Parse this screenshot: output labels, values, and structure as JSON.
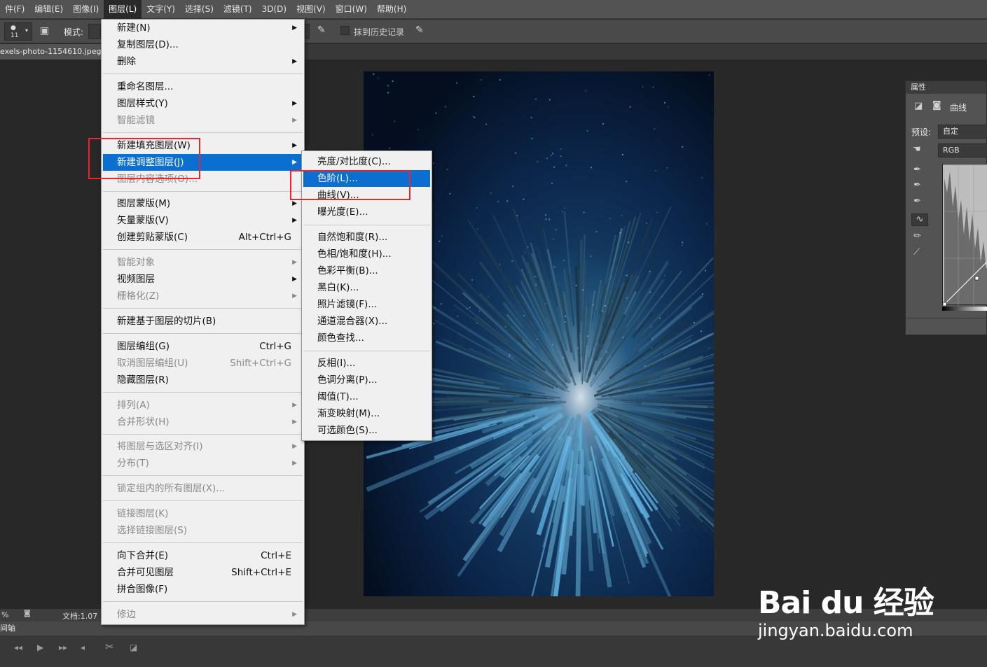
{
  "menubar": {
    "items": [
      {
        "label": "件(F)"
      },
      {
        "label": "编辑(E)"
      },
      {
        "label": "图像(I)"
      },
      {
        "label": "图层(L)",
        "active": true
      },
      {
        "label": "文字(Y)"
      },
      {
        "label": "选择(S)"
      },
      {
        "label": "滤镜(T)"
      },
      {
        "label": "3D(D)"
      },
      {
        "label": "视图(V)"
      },
      {
        "label": "窗口(W)"
      },
      {
        "label": "帮助(H)"
      }
    ]
  },
  "options_bar": {
    "brush_size": "11",
    "mode_label": "模式:",
    "history_label": "抹到历史记录"
  },
  "document": {
    "tab_title": "exels-photo-1154610.jpeg"
  },
  "status_bar": {
    "zoom": "%",
    "doc_info": "文档:1.07"
  },
  "timeline": {
    "title": "间轴"
  },
  "properties_panel": {
    "title": "属性",
    "type_label": "曲线",
    "preset_label": "预设:",
    "preset_value": "自定",
    "channel_value": "RGB"
  },
  "layer_menu": {
    "items": [
      {
        "label": "新建(N)",
        "submenu": true
      },
      {
        "label": "复制图层(D)..."
      },
      {
        "label": "删除",
        "submenu": true
      },
      {
        "separator": true
      },
      {
        "label": "重命名图层..."
      },
      {
        "label": "图层样式(Y)",
        "submenu": true
      },
      {
        "label": "智能滤镜",
        "disabled": true,
        "submenu": true
      },
      {
        "separator": true
      },
      {
        "label": "新建填充图层(W)",
        "submenu": true
      },
      {
        "label": "新建调整图层(J)",
        "submenu": true,
        "highlight": true
      },
      {
        "label": "图层内容选项(O)...",
        "disabled": true
      },
      {
        "separator": true
      },
      {
        "label": "图层蒙版(M)",
        "submenu": true
      },
      {
        "label": "矢量蒙版(V)",
        "submenu": true
      },
      {
        "label": "创建剪贴蒙版(C)",
        "shortcut": "Alt+Ctrl+G"
      },
      {
        "separator": true
      },
      {
        "label": "智能对象",
        "disabled": true,
        "submenu": true
      },
      {
        "label": "视频图层",
        "submenu": true
      },
      {
        "label": "栅格化(Z)",
        "disabled": true,
        "submenu": true
      },
      {
        "separator": true
      },
      {
        "label": "新建基于图层的切片(B)"
      },
      {
        "separator": true
      },
      {
        "label": "图层编组(G)",
        "shortcut": "Ctrl+G"
      },
      {
        "label": "取消图层编组(U)",
        "shortcut": "Shift+Ctrl+G",
        "disabled": true
      },
      {
        "label": "隐藏图层(R)"
      },
      {
        "separator": true
      },
      {
        "label": "排列(A)",
        "disabled": true,
        "submenu": true
      },
      {
        "label": "合并形状(H)",
        "disabled": true,
        "submenu": true
      },
      {
        "separator": true
      },
      {
        "label": "将图层与选区对齐(I)",
        "disabled": true,
        "submenu": true
      },
      {
        "label": "分布(T)",
        "disabled": true,
        "submenu": true
      },
      {
        "separator": true
      },
      {
        "label": "锁定组内的所有图层(X)...",
        "disabled": true
      },
      {
        "separator": true
      },
      {
        "label": "链接图层(K)",
        "disabled": true
      },
      {
        "label": "选择链接图层(S)",
        "disabled": true
      },
      {
        "separator": true
      },
      {
        "label": "向下合并(E)",
        "shortcut": "Ctrl+E"
      },
      {
        "label": "合并可见图层",
        "shortcut": "Shift+Ctrl+E"
      },
      {
        "label": "拼合图像(F)"
      },
      {
        "separator": true
      },
      {
        "label": "修边",
        "disabled": true,
        "submenu": true
      }
    ]
  },
  "adjust_submenu": {
    "items": [
      {
        "label": "亮度/对比度(C)..."
      },
      {
        "label": "色阶(L)...",
        "highlight": true
      },
      {
        "label": "曲线(V)..."
      },
      {
        "label": "曝光度(E)..."
      },
      {
        "separator": true
      },
      {
        "label": "自然饱和度(R)..."
      },
      {
        "label": "色相/饱和度(H)..."
      },
      {
        "label": "色彩平衡(B)..."
      },
      {
        "label": "黑白(K)..."
      },
      {
        "label": "照片滤镜(F)..."
      },
      {
        "label": "通道混合器(X)..."
      },
      {
        "label": "颜色查找..."
      },
      {
        "separator": true
      },
      {
        "label": "反相(I)..."
      },
      {
        "label": "色调分离(P)..."
      },
      {
        "label": "阈值(T)..."
      },
      {
        "label": "渐变映射(M)..."
      },
      {
        "label": "可选颜色(S)..."
      }
    ]
  },
  "watermark": {
    "brand": "Bai du 经验",
    "url": "jingyan.baidu.com"
  },
  "colors": {
    "highlight": "#0a6fd0",
    "annotation_red": "#e8262c"
  }
}
